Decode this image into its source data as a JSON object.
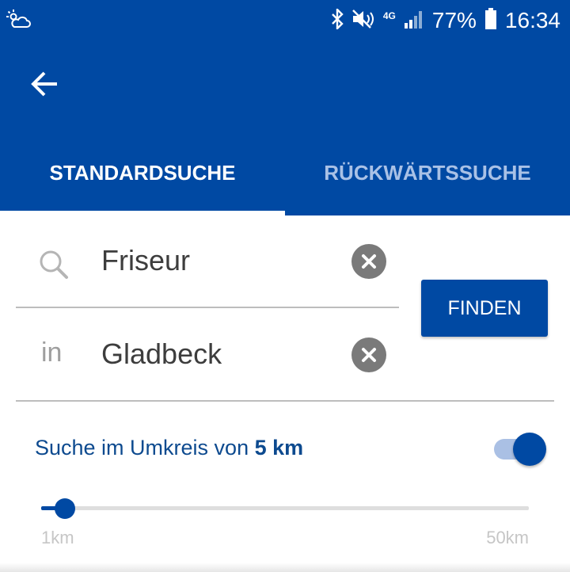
{
  "statusbar": {
    "battery_percent": "77%",
    "time": "16:34",
    "network": "4G"
  },
  "appbar": {
    "back_icon": "arrow-left-icon",
    "tabs": [
      {
        "label": "STANDARDSUCHE",
        "active": true
      },
      {
        "label": "RÜCKWÄRTSSUCHE",
        "active": false
      }
    ]
  },
  "search": {
    "what_value": "Friseur",
    "where_prefix": "in",
    "where_value": "Gladbeck",
    "submit_label": "FINDEN"
  },
  "radius": {
    "label_prefix": "Suche im Umkreis von",
    "value_label": "5 km",
    "enabled": true,
    "slider_min_label": "1km",
    "slider_max_label": "50km",
    "slider_min": 1,
    "slider_max": 50,
    "slider_value": 5
  },
  "colors": {
    "brand": "#0049a3",
    "tab_inactive": "#a9c1e6",
    "label_blue": "#0d4a8f"
  }
}
